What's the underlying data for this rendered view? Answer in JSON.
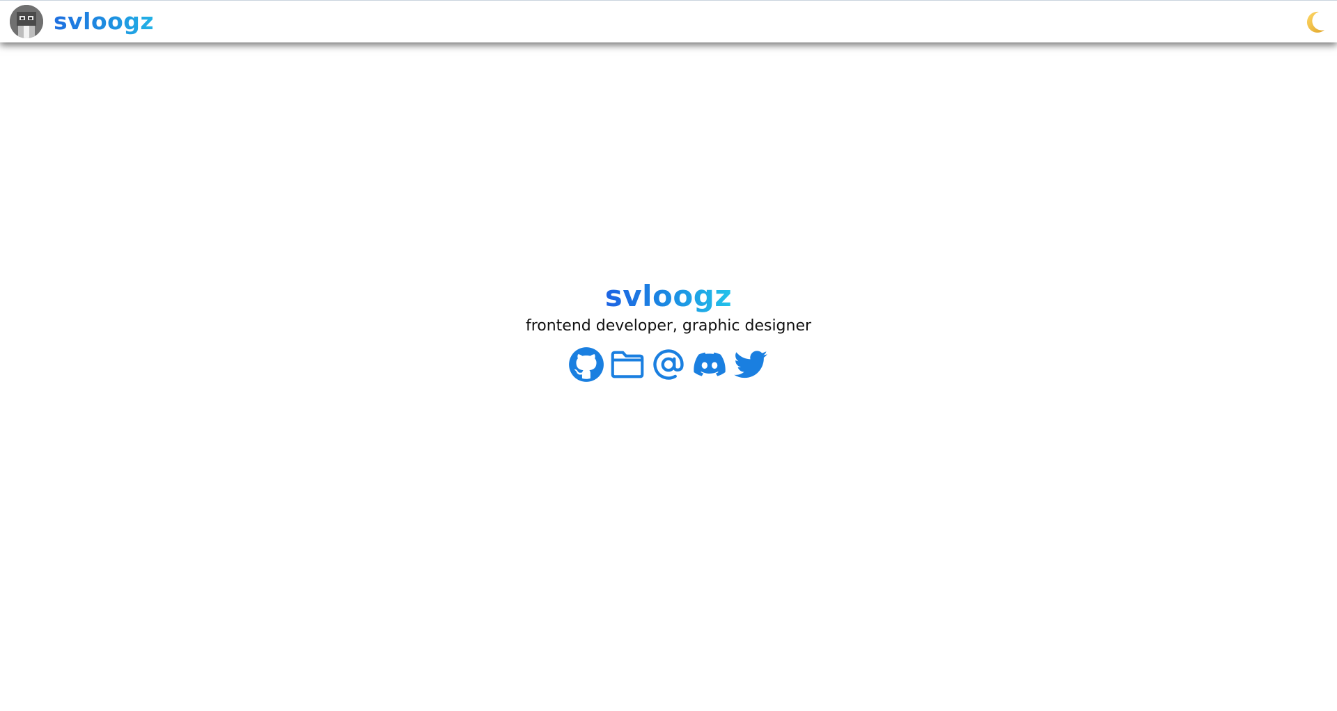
{
  "navbar": {
    "brand": "svloogz",
    "avatar_icon": "avatar-icon",
    "theme_toggle_icon": "moon-icon"
  },
  "hero": {
    "title": "svloogz",
    "subtitle": "frontend developer, graphic designer"
  },
  "social_links": [
    {
      "icon": "github-icon"
    },
    {
      "icon": "folder-icon"
    },
    {
      "icon": "at-icon"
    },
    {
      "icon": "discord-icon"
    },
    {
      "icon": "twitter-icon"
    }
  ],
  "colors": {
    "accent": "#1a7fe0",
    "gradient_start": "#1d63e3",
    "gradient_end": "#22c3ea",
    "moon": "#f5c542"
  }
}
